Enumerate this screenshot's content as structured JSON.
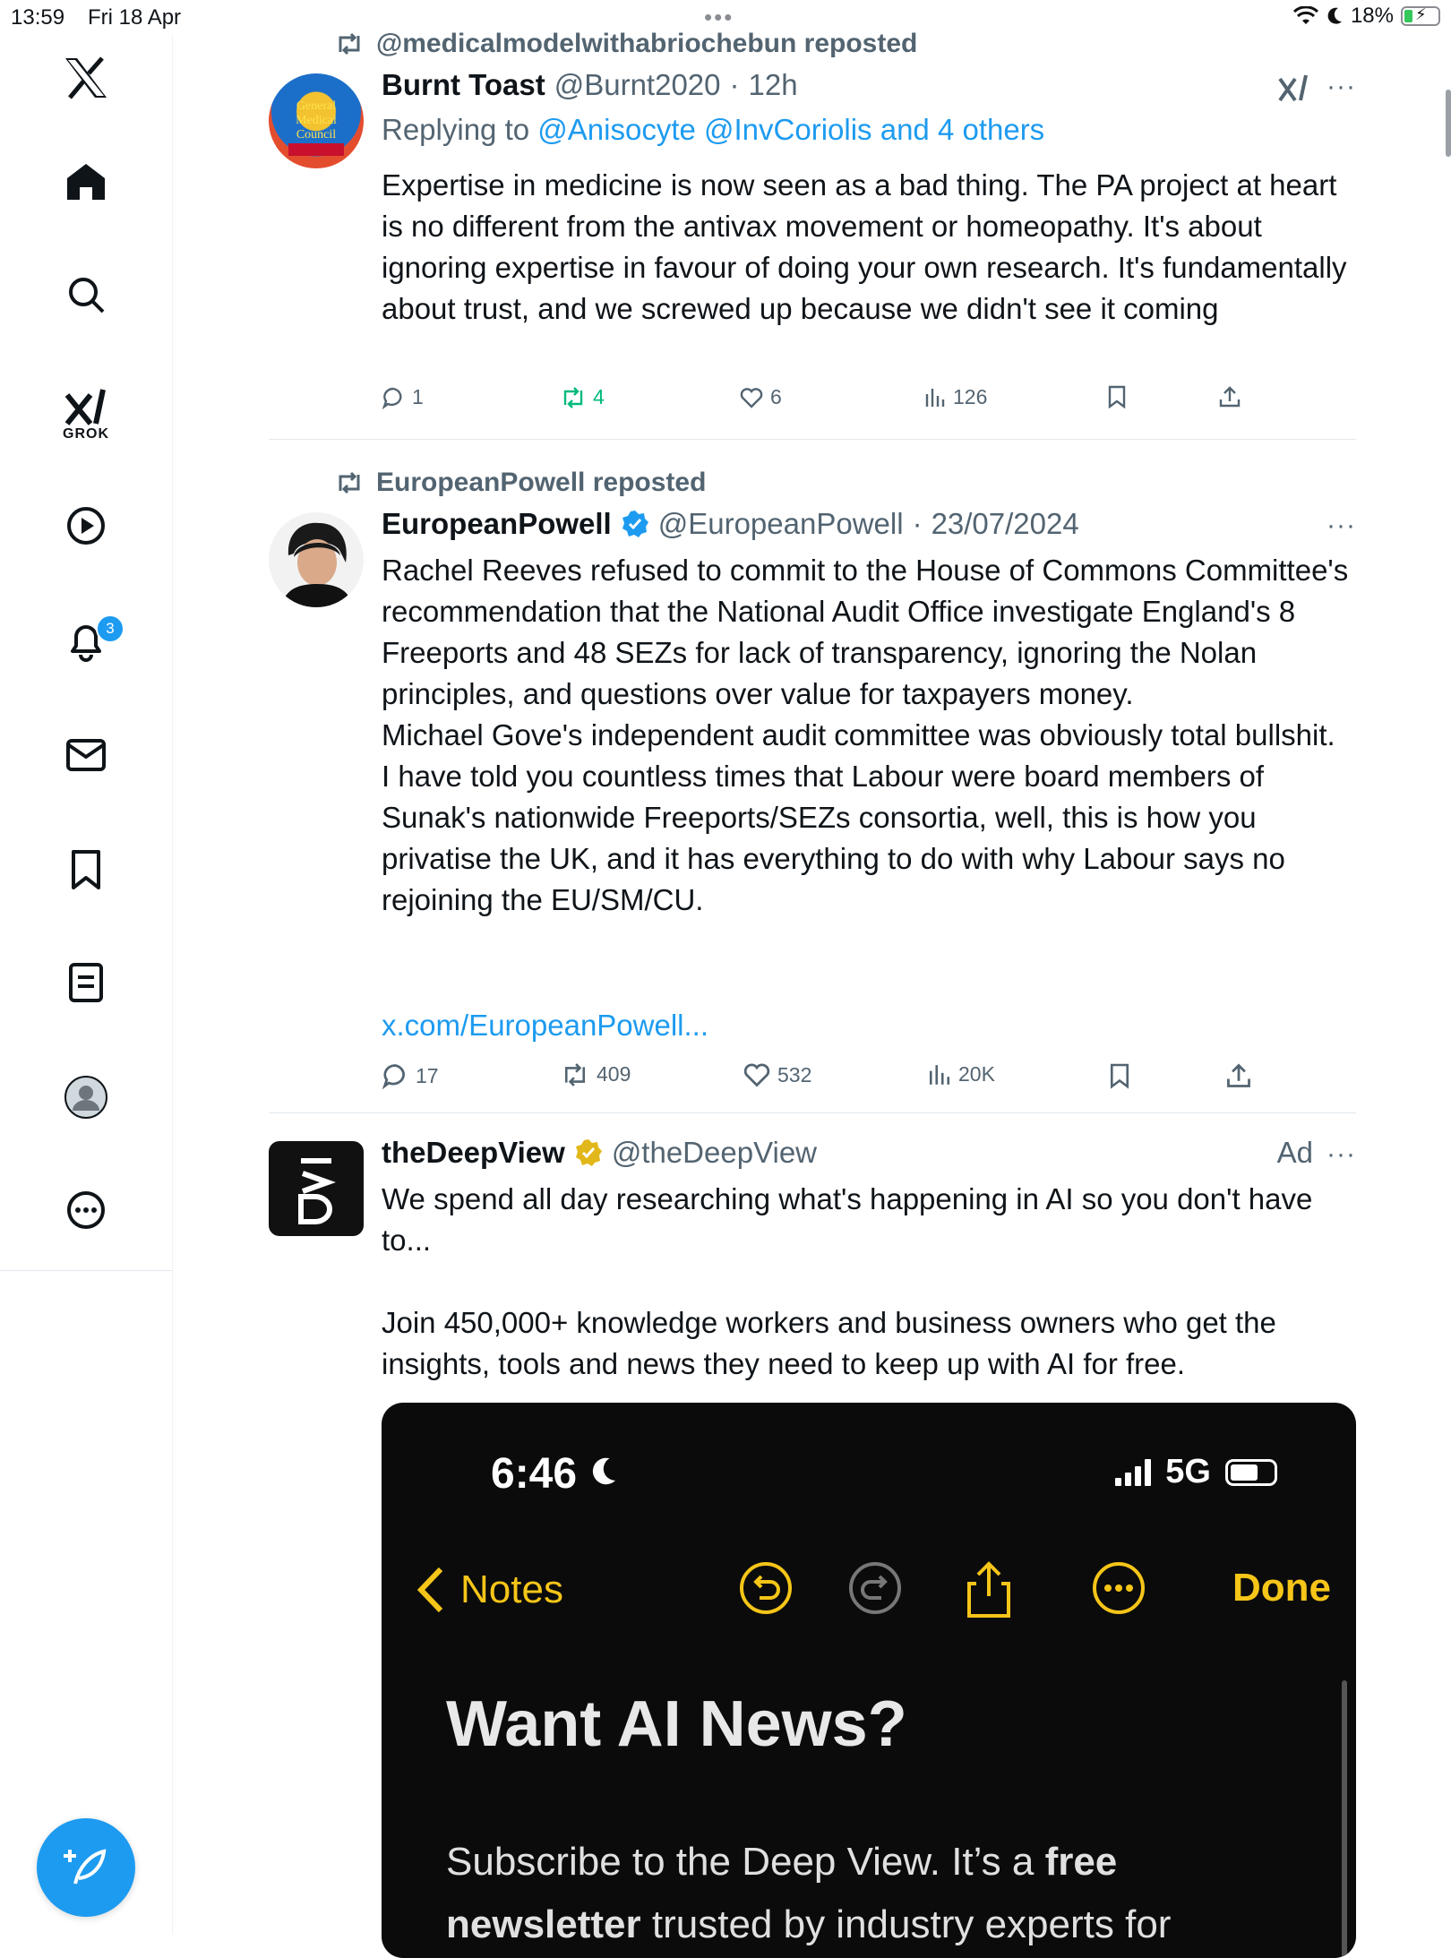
{
  "status_bar": {
    "time": "13:59",
    "date": "Fri 18 Apr",
    "battery": "18%"
  },
  "sidebar": {
    "grok_label": "GROK",
    "notifications_badge": "3"
  },
  "posts": [
    {
      "repost_by": "@medicalmodelwithabriochebun reposted",
      "name": "Burnt Toast",
      "handle": "@Burnt2020",
      "time": "12h",
      "replying_prefix": "Replying to ",
      "replying_to": "@Anisocyte @InvCoriolis and 4 others",
      "text": "Expertise in medicine is now seen as a bad thing. The PA project at heart is no different from the antivax movement or homeopathy. It's about ignoring expertise in favour of doing your own research. It's fundamentally about trust, and we screwed up because we didn't see it coming",
      "replies": "1",
      "reposts": "4",
      "likes": "6",
      "views": "126"
    },
    {
      "repost_by": "EuropeanPowell reposted",
      "name": "EuropeanPowell",
      "handle": "@EuropeanPowell",
      "time": "23/07/2024",
      "text": "Rachel Reeves refused to commit to the House of Commons Committee's recommendation that the National Audit Office investigate England's 8 Freeports and 48 SEZs for lack of transparency, ignoring the Nolan principles, and questions over value for taxpayers money.\nMichael Gove's independent audit committee was obviously total bullshit.\nI have told you countless times that Labour were board members of Sunak's nationwide Freeports/SEZs consortia, well, this is how you privatise the UK, and it has everything to do with why Labour says no rejoining the EU/SM/CU.",
      "link": "x.com/EuropeanPowell...",
      "replies": "17",
      "reposts": "409",
      "likes": "532",
      "views": "20K"
    },
    {
      "name": "theDeepView",
      "handle": "@theDeepView",
      "ad_label": "Ad",
      "text": "We spend all day researching what's happening in AI so you don't have to...\n\nJoin 450,000+ knowledge workers and business owners who get the insights, tools and news they need to keep up with AI for free.",
      "media": {
        "phone_time": "6:46",
        "network": "5G",
        "back_label": "Notes",
        "done_label": "Done",
        "title": "Want AI News?",
        "subtitle_1": "Subscribe to the Deep View. It’s a ",
        "subtitle_bold": "free",
        "subtitle_2": "newsletter",
        "subtitle_3": " trusted by industry experts for"
      }
    }
  ],
  "colors": {
    "accent": "#1d9bf0",
    "repost_green": "#00ba7c",
    "secondary_text": "#536471"
  }
}
